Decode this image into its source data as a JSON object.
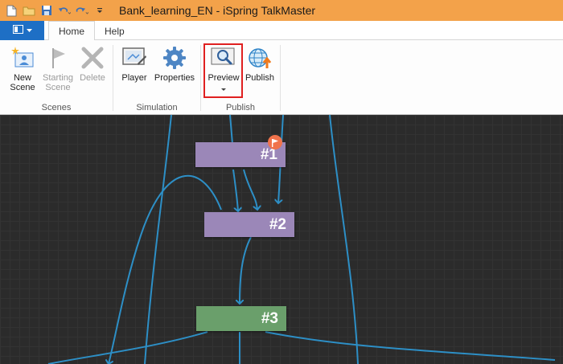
{
  "window": {
    "title": "Bank_learning_EN - iSpring TalkMaster"
  },
  "quick_access": [
    {
      "name": "new-file-icon"
    },
    {
      "name": "open-folder-icon"
    },
    {
      "name": "save-icon"
    },
    {
      "name": "undo-icon"
    },
    {
      "name": "redo-icon"
    },
    {
      "name": "customize-dropdown-icon"
    }
  ],
  "tabs": [
    {
      "label": "Home",
      "active": true
    },
    {
      "label": "Help",
      "active": false
    }
  ],
  "ribbon": {
    "scenes": {
      "caption": "Scenes",
      "new_scene": {
        "line1": "New",
        "line2": "Scene"
      },
      "starting_scene": {
        "line1": "Starting",
        "line2": "Scene"
      },
      "delete": {
        "label": "Delete"
      }
    },
    "simulation": {
      "caption": "Simulation",
      "player": {
        "label": "Player"
      },
      "properties": {
        "label": "Properties"
      }
    },
    "publish": {
      "caption": "Publish",
      "preview": {
        "label": "Preview"
      },
      "publish": {
        "label": "Publish"
      }
    }
  },
  "canvas": {
    "nodes": [
      {
        "label": "#1",
        "color": "#9b87b8",
        "starting": true
      },
      {
        "label": "#2",
        "color": "#9b87b8",
        "starting": false
      },
      {
        "label": "#3",
        "color": "#6a9f6b",
        "starting": false
      }
    ],
    "link_color": "#2d8fc6",
    "flag_color": "#f0734c"
  },
  "colors": {
    "title_bar": "#f3a24a",
    "file_button": "#1e6fc5",
    "highlight": "#e02020"
  }
}
